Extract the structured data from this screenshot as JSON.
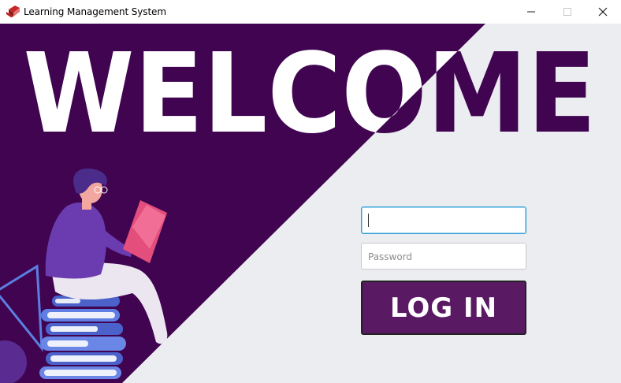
{
  "window": {
    "title": "Learning Management System",
    "icon": "book-icon",
    "controls": [
      "minimize-icon",
      "maximize-icon",
      "close-icon"
    ]
  },
  "banner": {
    "welcome_text": "WELCOME"
  },
  "login": {
    "username_value": "",
    "password_placeholder": "Password",
    "button_label": "LOG IN"
  },
  "colors": {
    "brand_purple": "#400451",
    "button_purple": "#5a1a63",
    "background_gray": "#ecedf0",
    "focus_blue": "#2fa0d8"
  }
}
